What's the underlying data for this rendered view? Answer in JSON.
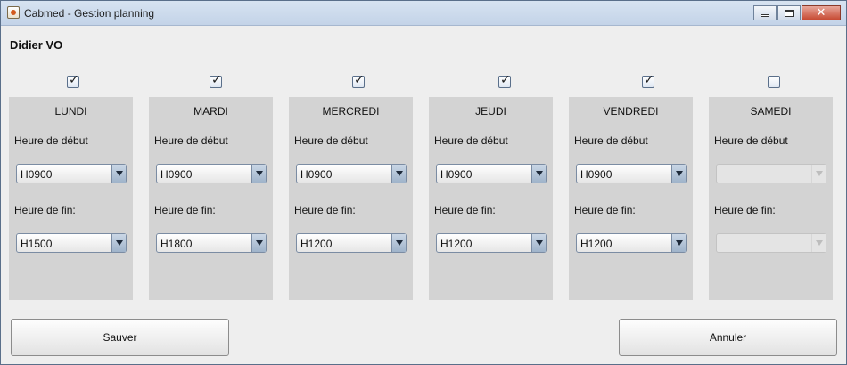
{
  "window": {
    "title": "Cabmed - Gestion planning",
    "minimize_icon": "minimize-icon",
    "maximize_icon": "maximize-icon",
    "close_icon": "close-icon"
  },
  "doctor": {
    "name": "Didier VO"
  },
  "labels": {
    "start": "Heure de début",
    "end": "Heure de fin:"
  },
  "days": [
    {
      "name": "LUNDI",
      "checked": true,
      "start": "H0900",
      "end": "H1500",
      "enabled": true
    },
    {
      "name": "MARDI",
      "checked": true,
      "start": "H0900",
      "end": "H1800",
      "enabled": true
    },
    {
      "name": "MERCREDI",
      "checked": true,
      "start": "H0900",
      "end": "H1200",
      "enabled": true
    },
    {
      "name": "JEUDI",
      "checked": true,
      "start": "H0900",
      "end": "H1200",
      "enabled": true
    },
    {
      "name": "VENDREDI",
      "checked": true,
      "start": "H0900",
      "end": "H1200",
      "enabled": true
    },
    {
      "name": "SAMEDI",
      "checked": false,
      "start": "",
      "end": "",
      "enabled": false
    }
  ],
  "buttons": {
    "save": "Sauver",
    "cancel": "Annuler"
  }
}
